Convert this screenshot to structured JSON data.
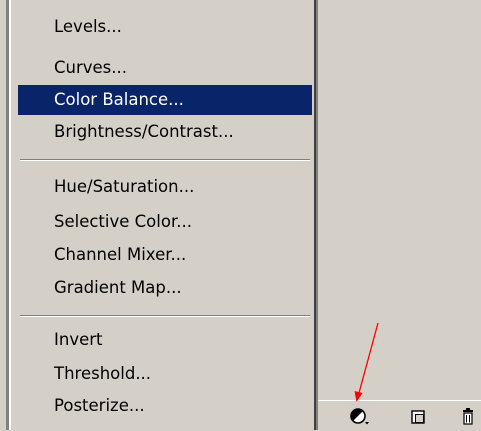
{
  "menu": {
    "items": [
      {
        "label": "Levels..."
      },
      {
        "label": "Curves..."
      },
      {
        "label": "Color Balance...",
        "selected": true
      },
      {
        "label": "Brightness/Contrast..."
      },
      {
        "label": "Hue/Saturation..."
      },
      {
        "label": "Selective Color..."
      },
      {
        "label": "Channel Mixer..."
      },
      {
        "label": "Gradient Map..."
      },
      {
        "label": "Invert"
      },
      {
        "label": "Threshold..."
      },
      {
        "label": "Posterize..."
      }
    ]
  },
  "toolbar": {
    "icons": [
      {
        "name": "adjustment-layer-icon"
      },
      {
        "name": "new-layer-icon"
      },
      {
        "name": "trash-icon"
      }
    ]
  },
  "colors": {
    "menu_background": "#d4d0c8",
    "selection": "#0a246a",
    "arrow": "#ff0000"
  }
}
